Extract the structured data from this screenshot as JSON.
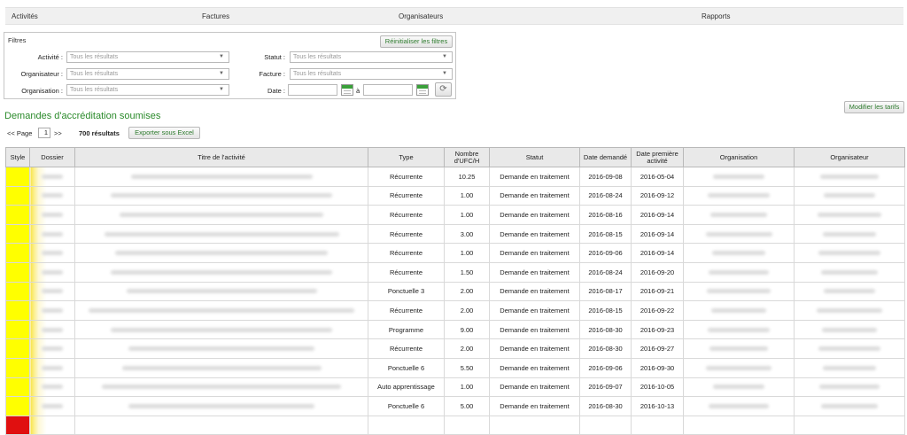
{
  "nav": [
    {
      "label": "Activités"
    },
    {
      "label": "Factures"
    },
    {
      "label": "Organisateurs"
    },
    {
      "label": "Rapports"
    }
  ],
  "filters": {
    "title": "Filtres",
    "reset_label": "Réinitialiser les filtres",
    "activite_label": "Activité :",
    "organisateur_label": "Organisateur :",
    "organisation_label": "Organisation :",
    "statut_label": "Statut :",
    "facture_label": "Facture :",
    "date_label": "Date :",
    "date_sep": "à",
    "placeholder": "Tous les résultats"
  },
  "modify_rates_label": "Modifier les tarifs",
  "section_title": "Demandes d'accréditation soumises",
  "pager": {
    "prev": "<< Page",
    "page": "1",
    "next": ">>"
  },
  "results_label": "700 résultats",
  "export_label": "Exporter sous Excel",
  "colors": {
    "accent_green": "#2a8a2a",
    "style_yellow": "#ffff00",
    "style_red": "#e01010"
  },
  "table": {
    "headers": [
      "Style",
      "Dossier",
      "Titre de l'activité",
      "Type",
      "Nombre d'UFC/H",
      "Statut",
      "Date demandé",
      "Date première activité",
      "Organisation",
      "Organisateur"
    ],
    "rows": [
      {
        "type": "Récurrente",
        "ufc": "10.25",
        "statut": "Demande en traitement",
        "date_demande": "2016-09-08",
        "date_premiere": "2016-05-04"
      },
      {
        "type": "Récurrente",
        "ufc": "1.00",
        "statut": "Demande en traitement",
        "date_demande": "2016-08-24",
        "date_premiere": "2016-09-12"
      },
      {
        "type": "Récurrente",
        "ufc": "1.00",
        "statut": "Demande en traitement",
        "date_demande": "2016-08-16",
        "date_premiere": "2016-09-14"
      },
      {
        "type": "Récurrente",
        "ufc": "3.00",
        "statut": "Demande en traitement",
        "date_demande": "2016-08-15",
        "date_premiere": "2016-09-14"
      },
      {
        "type": "Récurrente",
        "ufc": "1.00",
        "statut": "Demande en traitement",
        "date_demande": "2016-09-06",
        "date_premiere": "2016-09-14"
      },
      {
        "type": "Récurrente",
        "ufc": "1.50",
        "statut": "Demande en traitement",
        "date_demande": "2016-08-24",
        "date_premiere": "2016-09-20"
      },
      {
        "type": "Ponctuelle 3",
        "ufc": "2.00",
        "statut": "Demande en traitement",
        "date_demande": "2016-08-17",
        "date_premiere": "2016-09-21"
      },
      {
        "type": "Récurrente",
        "ufc": "2.00",
        "statut": "Demande en traitement",
        "date_demande": "2016-08-15",
        "date_premiere": "2016-09-22"
      },
      {
        "type": "Programme",
        "ufc": "9.00",
        "statut": "Demande en traitement",
        "date_demande": "2016-08-30",
        "date_premiere": "2016-09-23"
      },
      {
        "type": "Récurrente",
        "ufc": "2.00",
        "statut": "Demande en traitement",
        "date_demande": "2016-08-30",
        "date_premiere": "2016-09-27"
      },
      {
        "type": "Ponctuelle 6",
        "ufc": "5.50",
        "statut": "Demande en traitement",
        "date_demande": "2016-09-06",
        "date_premiere": "2016-09-30"
      },
      {
        "type": "Auto apprentissage",
        "ufc": "1.00",
        "statut": "Demande en traitement",
        "date_demande": "2016-09-07",
        "date_premiere": "2016-10-05"
      },
      {
        "type": "Ponctuelle 6",
        "ufc": "5.00",
        "statut": "Demande en traitement",
        "date_demande": "2016-08-30",
        "date_premiere": "2016-10-13"
      }
    ]
  }
}
